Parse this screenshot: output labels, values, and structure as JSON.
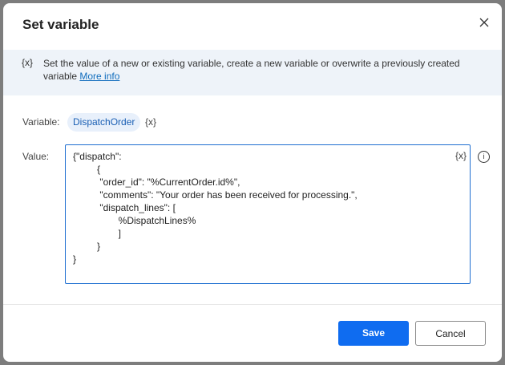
{
  "dialog": {
    "title": "Set variable",
    "info_icon": "{x}",
    "info_text": "Set the value of a new or existing variable, create a new variable or overwrite a previously created variable",
    "more_info": "More info",
    "variable_label": "Variable:",
    "variable_name": "DispatchOrder",
    "variable_picker": "{x}",
    "value_label": "Value:",
    "value": "{\"dispatch\":\n         {\n          \"order_id\": \"%CurrentOrder.id%\",\n          \"comments\": \"Your order has been received for processing.\",\n          \"dispatch_lines\": [\n                 %DispatchLines%\n                 ]\n         }\n}",
    "value_picker": "{x}",
    "info_glyph": "i",
    "save": "Save",
    "cancel": "Cancel"
  },
  "colors": {
    "accent": "#0f6cf0",
    "info_band": "#eef3f9"
  }
}
